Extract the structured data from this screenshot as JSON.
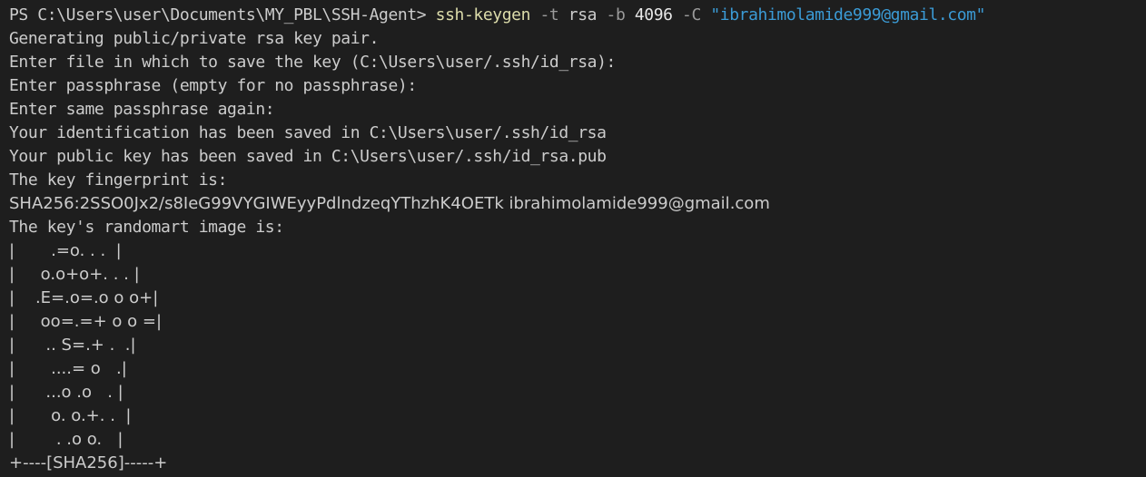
{
  "prompt": {
    "ps": "PS C:\\Users\\user\\Documents\\MY_PBL\\SSH-Agent> ",
    "command": "ssh-keygen",
    "flag_t": " -t",
    "value_t": " rsa",
    "flag_b": " -b",
    "value_b": " 4096",
    "flag_c": " -C",
    "value_c": " \"ibrahimolamide999@gmail.com\""
  },
  "output": [
    "Generating public/private rsa key pair.",
    "Enter file in which to save the key (C:\\Users\\user/.ssh/id_rsa):",
    "Enter passphrase (empty for no passphrase):",
    "Enter same passphrase again:",
    "Your identification has been saved in C:\\Users\\user/.ssh/id_rsa",
    "Your public key has been saved in C:\\Users\\user/.ssh/id_rsa.pub",
    "The key fingerprint is:",
    "SHA256:2SSO0Jx2/s8IeG99VYGIWEyyPdlndzeqYThzhK4OETk ibrahimolamide999@gmail.com",
    "The key's randomart image is:"
  ],
  "randomart": [
    "|       .=o. . .  |",
    "|     o.o+o+. . . |",
    "|    .E=.o=.o o o+|",
    "|     oo=.=+ o o =|",
    "|      .. S=.+ .  .|",
    "|       ....= o   .|",
    "|      ...o .o   . |",
    "|       o. o.+. .  |",
    "|        . .o o.   |",
    "+----[SHA256]-----+"
  ],
  "colors": {
    "background": "#1e1e1e",
    "text": "#cccccc",
    "command": "#dcdcaa",
    "parameter": "#9a9a9a",
    "string": "#3b9bd6"
  }
}
